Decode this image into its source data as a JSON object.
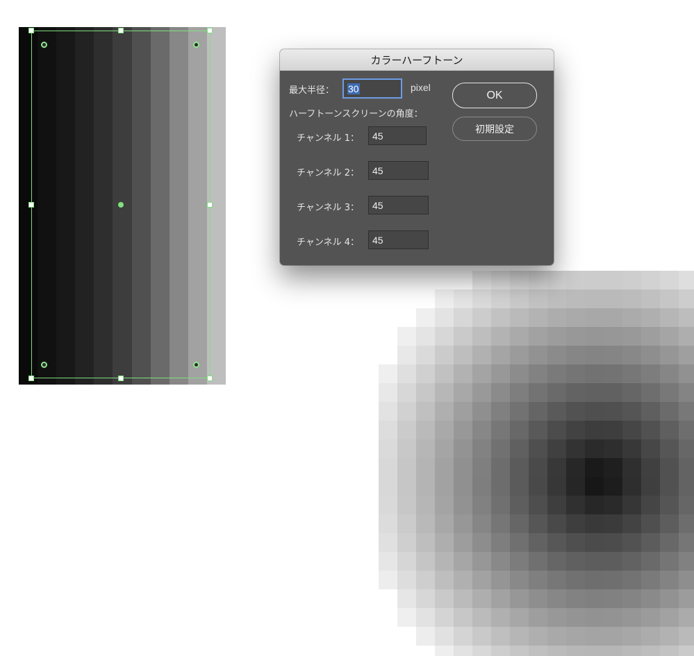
{
  "artboard": {
    "strip_colors": [
      "#0a0a0a",
      "#111111",
      "#181818",
      "#222222",
      "#2e2e2e",
      "#3d3d3d",
      "#505050",
      "#6a6a6a",
      "#878787",
      "#a2a2a2",
      "#bebebe"
    ]
  },
  "halftone": {
    "base_color": "#0e0e0e"
  },
  "dialog": {
    "title": "カラーハーフトーン",
    "max_radius_label": "最大半径：",
    "max_radius_value": "30",
    "unit": "pixel",
    "angle_section_label": "ハーフトーンスクリーンの角度：",
    "channels": [
      {
        "label": "チャンネル 1：",
        "value": "45"
      },
      {
        "label": "チャンネル 2：",
        "value": "45"
      },
      {
        "label": "チャンネル 3：",
        "value": "45"
      },
      {
        "label": "チャンネル 4：",
        "value": "45"
      }
    ],
    "ok_label": "OK",
    "reset_label": "初期設定"
  }
}
